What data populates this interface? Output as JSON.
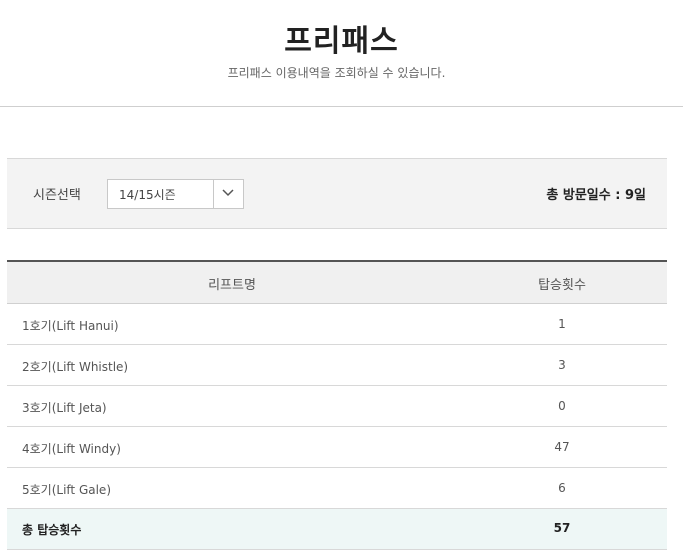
{
  "header": {
    "title": "프리패스",
    "subtitle": "프리패스 이용내역을 조회하실 수 있습니다."
  },
  "filter": {
    "season_label": "시즌선택",
    "season_selected": "14/15시즌",
    "visit_summary": "총 방문일수 : 9일"
  },
  "table": {
    "columns": [
      "리프트명",
      "탑승횟수"
    ],
    "rows": [
      {
        "name": "1호기(Lift Hanui)",
        "count": "1"
      },
      {
        "name": "2호기(Lift Whistle)",
        "count": "3"
      },
      {
        "name": "3호기(Lift Jeta)",
        "count": "0"
      },
      {
        "name": "4호기(Lift Windy)",
        "count": "47"
      },
      {
        "name": "5호기(Lift Gale)",
        "count": "6"
      }
    ],
    "total_label": "총 탑승횟수",
    "total_value": "57"
  },
  "icons": {
    "dropdown": "chevron-down-icon"
  }
}
